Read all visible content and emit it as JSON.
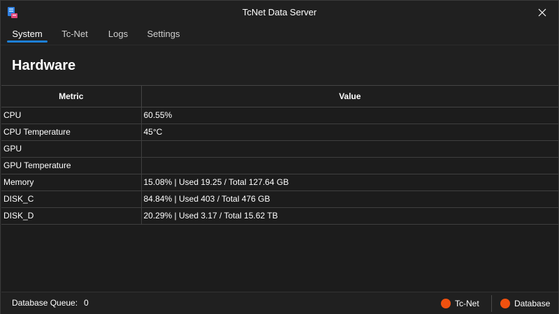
{
  "window": {
    "title": "TcNet Data Server"
  },
  "tabs": [
    {
      "label": "System",
      "active": true
    },
    {
      "label": "Tc-Net",
      "active": false
    },
    {
      "label": "Logs",
      "active": false
    },
    {
      "label": "Settings",
      "active": false
    }
  ],
  "section": {
    "heading": "Hardware"
  },
  "table": {
    "headers": [
      "Metric",
      "Value"
    ],
    "rows": [
      {
        "metric": "CPU",
        "value": "60.55%"
      },
      {
        "metric": "CPU Temperature",
        "value": "45°C"
      },
      {
        "metric": "GPU",
        "value": ""
      },
      {
        "metric": "GPU Temperature",
        "value": ""
      },
      {
        "metric": "Memory",
        "value": "15.08% | Used 19.25 / Total 127.64 GB"
      },
      {
        "metric": "DISK_C",
        "value": "84.84% | Used 403 / Total 476 GB"
      },
      {
        "metric": "DISK_D",
        "value": "20.29% | Used 3.17 / Total 15.62 TB"
      }
    ]
  },
  "status": {
    "queue_label": "Database Queue:",
    "queue_value": "0",
    "indicators": [
      {
        "label": "Tc-Net",
        "color": "#f0510f"
      },
      {
        "label": "Database",
        "color": "#f0510f"
      }
    ]
  },
  "colors": {
    "accent": "#1d7fd6",
    "background": "#202020",
    "status_error": "#f0510f"
  }
}
